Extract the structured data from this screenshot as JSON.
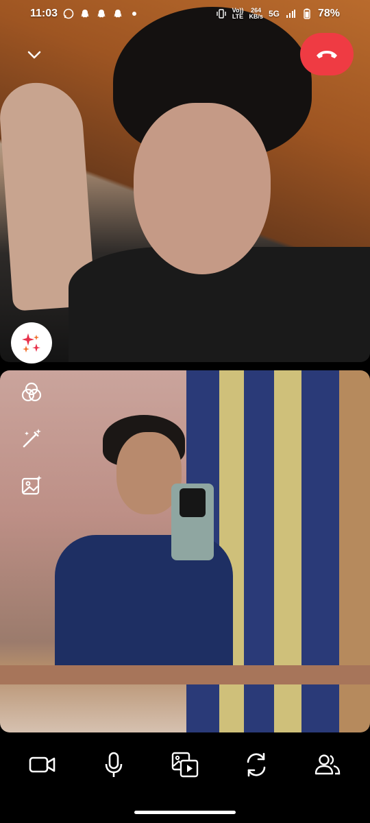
{
  "status_bar": {
    "time": "11:03",
    "network_rate_value": "264",
    "network_rate_unit": "KB/s",
    "volte_top": "Vo))",
    "volte_bottom": "LTE",
    "network_type": "5G",
    "battery": "78%",
    "notification_icons": [
      "whatsapp-icon",
      "snapchat-icon",
      "snapchat-icon",
      "snapchat-icon",
      "dot-icon"
    ]
  },
  "call": {
    "end_call_color": "#ef3b43",
    "remote_tile_label": "",
    "local_tile_label": ""
  },
  "side_tools": [
    "filters-icon",
    "magic-wand-icon",
    "ai-image-icon"
  ],
  "controls": [
    "video-camera-icon",
    "microphone-icon",
    "media-share-icon",
    "flip-camera-icon",
    "participants-icon"
  ]
}
